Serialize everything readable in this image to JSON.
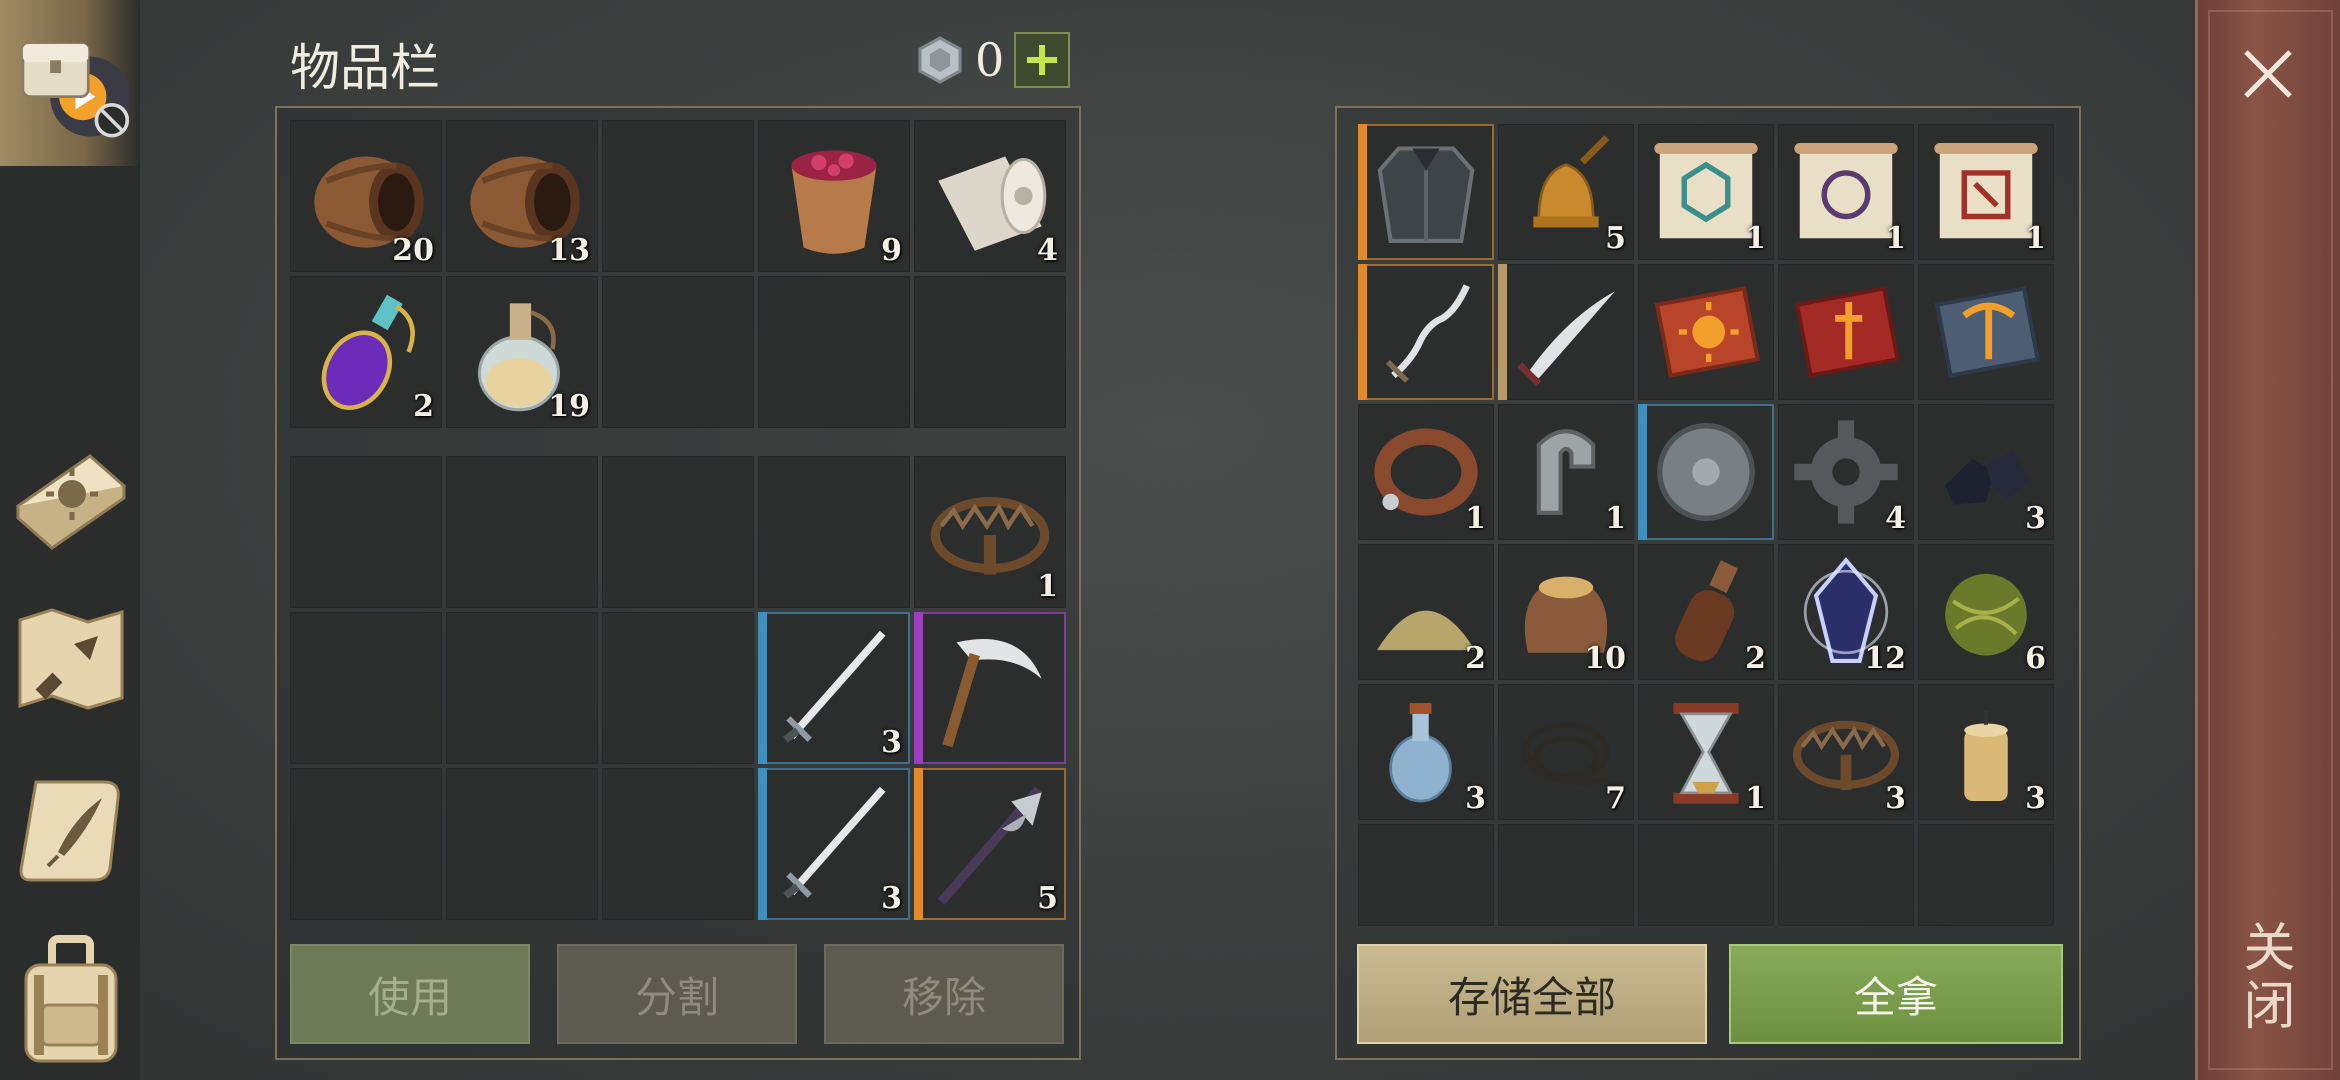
{
  "inventory": {
    "title": "物品栏",
    "currency_value": "0",
    "plus_label": "+",
    "top_slots": [
      {
        "icon": "barrel-icon",
        "qty": "20"
      },
      {
        "icon": "barrel-icon",
        "qty": "13"
      },
      {
        "icon": "empty",
        "qty": ""
      },
      {
        "icon": "berry-bucket-icon",
        "qty": "9"
      },
      {
        "icon": "cloth-roll-icon",
        "qty": "4"
      },
      {
        "icon": "purple-potion-icon",
        "qty": "2"
      },
      {
        "icon": "water-flask-icon",
        "qty": "19"
      },
      {
        "icon": "empty",
        "qty": ""
      },
      {
        "icon": "empty",
        "qty": ""
      },
      {
        "icon": "empty",
        "qty": ""
      }
    ],
    "bottom_slots": [
      {
        "icon": "empty",
        "qty": ""
      },
      {
        "icon": "empty",
        "qty": ""
      },
      {
        "icon": "empty",
        "qty": ""
      },
      {
        "icon": "empty",
        "qty": ""
      },
      {
        "icon": "bear-trap-icon",
        "qty": "1"
      },
      {
        "icon": "empty",
        "qty": ""
      },
      {
        "icon": "empty",
        "qty": ""
      },
      {
        "icon": "empty",
        "qty": ""
      },
      {
        "icon": "sword-icon",
        "qty": "3",
        "rarity": "blue"
      },
      {
        "icon": "scythe-icon",
        "qty": "",
        "rarity": "purple"
      },
      {
        "icon": "empty",
        "qty": ""
      },
      {
        "icon": "empty",
        "qty": ""
      },
      {
        "icon": "empty",
        "qty": ""
      },
      {
        "icon": "sword-icon",
        "qty": "3",
        "rarity": "blue"
      },
      {
        "icon": "halberd-icon",
        "qty": "5",
        "rarity": "orange"
      }
    ],
    "buttons": {
      "use": "使用",
      "split": "分割",
      "remove": "移除"
    }
  },
  "storage": {
    "slots": [
      {
        "icon": "chainmail-armor-icon",
        "qty": "",
        "rarity": "orange"
      },
      {
        "icon": "bell-icon",
        "qty": "5"
      },
      {
        "icon": "scroll-teal-icon",
        "qty": "1"
      },
      {
        "icon": "scroll-purple-icon",
        "qty": "1"
      },
      {
        "icon": "scroll-red-icon",
        "qty": "1"
      },
      {
        "icon": "wavy-dagger-icon",
        "qty": "",
        "rarity": "orange"
      },
      {
        "icon": "saber-icon",
        "qty": "",
        "rarity": "tan"
      },
      {
        "icon": "sun-book-icon",
        "qty": ""
      },
      {
        "icon": "sword-book-icon",
        "qty": ""
      },
      {
        "icon": "pickaxe-book-icon",
        "qty": ""
      },
      {
        "icon": "leather-collar-icon",
        "qty": "1"
      },
      {
        "icon": "iron-clamp-icon",
        "qty": "1"
      },
      {
        "icon": "round-shield-icon",
        "qty": "",
        "rarity": "blue"
      },
      {
        "icon": "gear-icon",
        "qty": "4"
      },
      {
        "icon": "coal-icon",
        "qty": "3"
      },
      {
        "icon": "sand-pile-icon",
        "qty": "2"
      },
      {
        "icon": "grain-sack-icon",
        "qty": "10"
      },
      {
        "icon": "leather-bottle-icon",
        "qty": "2"
      },
      {
        "icon": "crystal-icon",
        "qty": "12"
      },
      {
        "icon": "hay-ball-icon",
        "qty": "6"
      },
      {
        "icon": "glass-bottle-icon",
        "qty": "3"
      },
      {
        "icon": "rope-icon",
        "qty": "7"
      },
      {
        "icon": "hourglass-icon",
        "qty": "1"
      },
      {
        "icon": "bear-trap-icon",
        "qty": "3"
      },
      {
        "icon": "candle-icon",
        "qty": "3"
      },
      {
        "icon": "empty",
        "qty": ""
      },
      {
        "icon": "empty",
        "qty": ""
      },
      {
        "icon": "empty",
        "qty": ""
      },
      {
        "icon": "empty",
        "qty": ""
      },
      {
        "icon": "empty",
        "qty": ""
      }
    ],
    "buttons": {
      "store_all": "存储全部",
      "take_all": "全拿"
    }
  },
  "close_label": "关闭",
  "sidebar": [
    "chest-icon",
    "sun-book-icon",
    "crafting-map-icon",
    "quest-scroll-icon",
    "backpack-icon"
  ]
}
